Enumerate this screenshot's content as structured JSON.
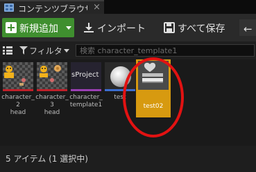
{
  "tab": {
    "title": "コンテンツブラウザ",
    "close": "×"
  },
  "toolbar": {
    "add_label": "新規追加",
    "import_label": "インポート",
    "save_label": "すべて保存",
    "back_arrow": "←"
  },
  "filter": {
    "label": "フィルタ",
    "search_placeholder": "検索 character_template1"
  },
  "assets": [
    {
      "name": "character_2head",
      "label": "character_2\nhead"
    },
    {
      "name": "character_3head",
      "label": "character_3\nhead"
    },
    {
      "name": "character_template1",
      "label": "character_\ntemplate1",
      "thumb_text": "sProject"
    },
    {
      "name": "test",
      "label": "test"
    },
    {
      "name": "test02",
      "label": "test02",
      "selected": true
    }
  ],
  "status": {
    "text": "5 アイテム (1 選択中)"
  },
  "colors": {
    "add_button": "#3f8f2f",
    "selected_tile": "#d79a10",
    "highlight": "#e21212"
  },
  "icons": {
    "tab": "content-browser-icon",
    "add": "plus-icon",
    "import": "import-icon",
    "save": "save-icon",
    "filter": "funnel-icon",
    "back": "back-arrow-icon"
  }
}
